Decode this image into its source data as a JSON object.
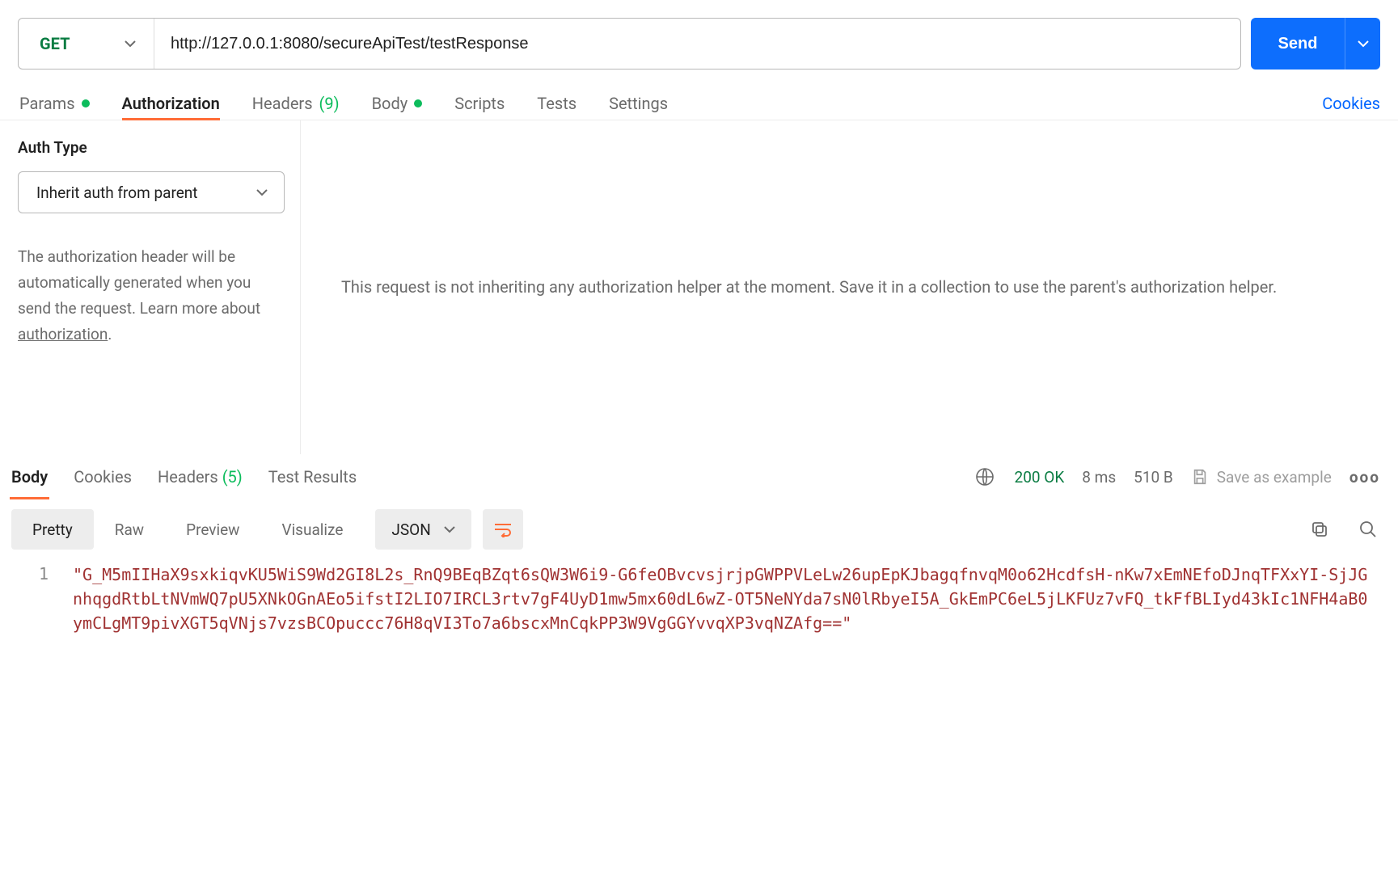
{
  "request": {
    "method": "GET",
    "url": "http://127.0.0.1:8080/secureApiTest/testResponse",
    "send_label": "Send"
  },
  "req_tabs": {
    "params": "Params",
    "authorization": "Authorization",
    "headers": "Headers",
    "headers_count": "(9)",
    "body": "Body",
    "scripts": "Scripts",
    "tests": "Tests",
    "settings": "Settings",
    "cookies": "Cookies"
  },
  "auth": {
    "title": "Auth Type",
    "selected": "Inherit auth from parent",
    "desc_pre": "The authorization header will be automatically generated when you send the request. Learn more about ",
    "desc_link": "authorization",
    "desc_post": "."
  },
  "right_msg": "This request is not inheriting any authorization helper at the moment. Save it in a collection to use the parent's authorization helper.",
  "res_tabs": {
    "body": "Body",
    "cookies": "Cookies",
    "headers": "Headers",
    "headers_count": "(5)",
    "test_results": "Test Results"
  },
  "res_meta": {
    "status": "200 OK",
    "time": "8 ms",
    "size": "510 B",
    "save_example": "Save as example"
  },
  "viewbar": {
    "pretty": "Pretty",
    "raw": "Raw",
    "preview": "Preview",
    "visualize": "Visualize",
    "lang": "JSON"
  },
  "code": {
    "line_no": "1",
    "text": "\"G_M5mIIHaX9sxkiqvKU5WiS9Wd2GI8L2s_RnQ9BEqBZqt6sQW3W6i9-G6feOBvcvsjrjpGWPPVLeLw26upEpKJbagqfnvqM0o62HcdfsH-nKw7xEmNEfoDJnqTFXxYI-SjJGnhqgdRtbLtNVmWQ7pU5XNkOGnAEo5ifstI2LIO7IRCL3rtv7gF4UyD1mw5mx60dL6wZ-OT5NeNYda7sN0lRbyeI5A_GkEmPC6eL5jLKFUz7vFQ_tkFfBLIyd43kIc1NFH4aB0ymCLgMT9pivXGT5qVNjs7vzsBCOpuccc76H8qVI3To7a6bscxMnCqkPP3W9VgGGYvvqXP3vqNZAfg==\""
  }
}
